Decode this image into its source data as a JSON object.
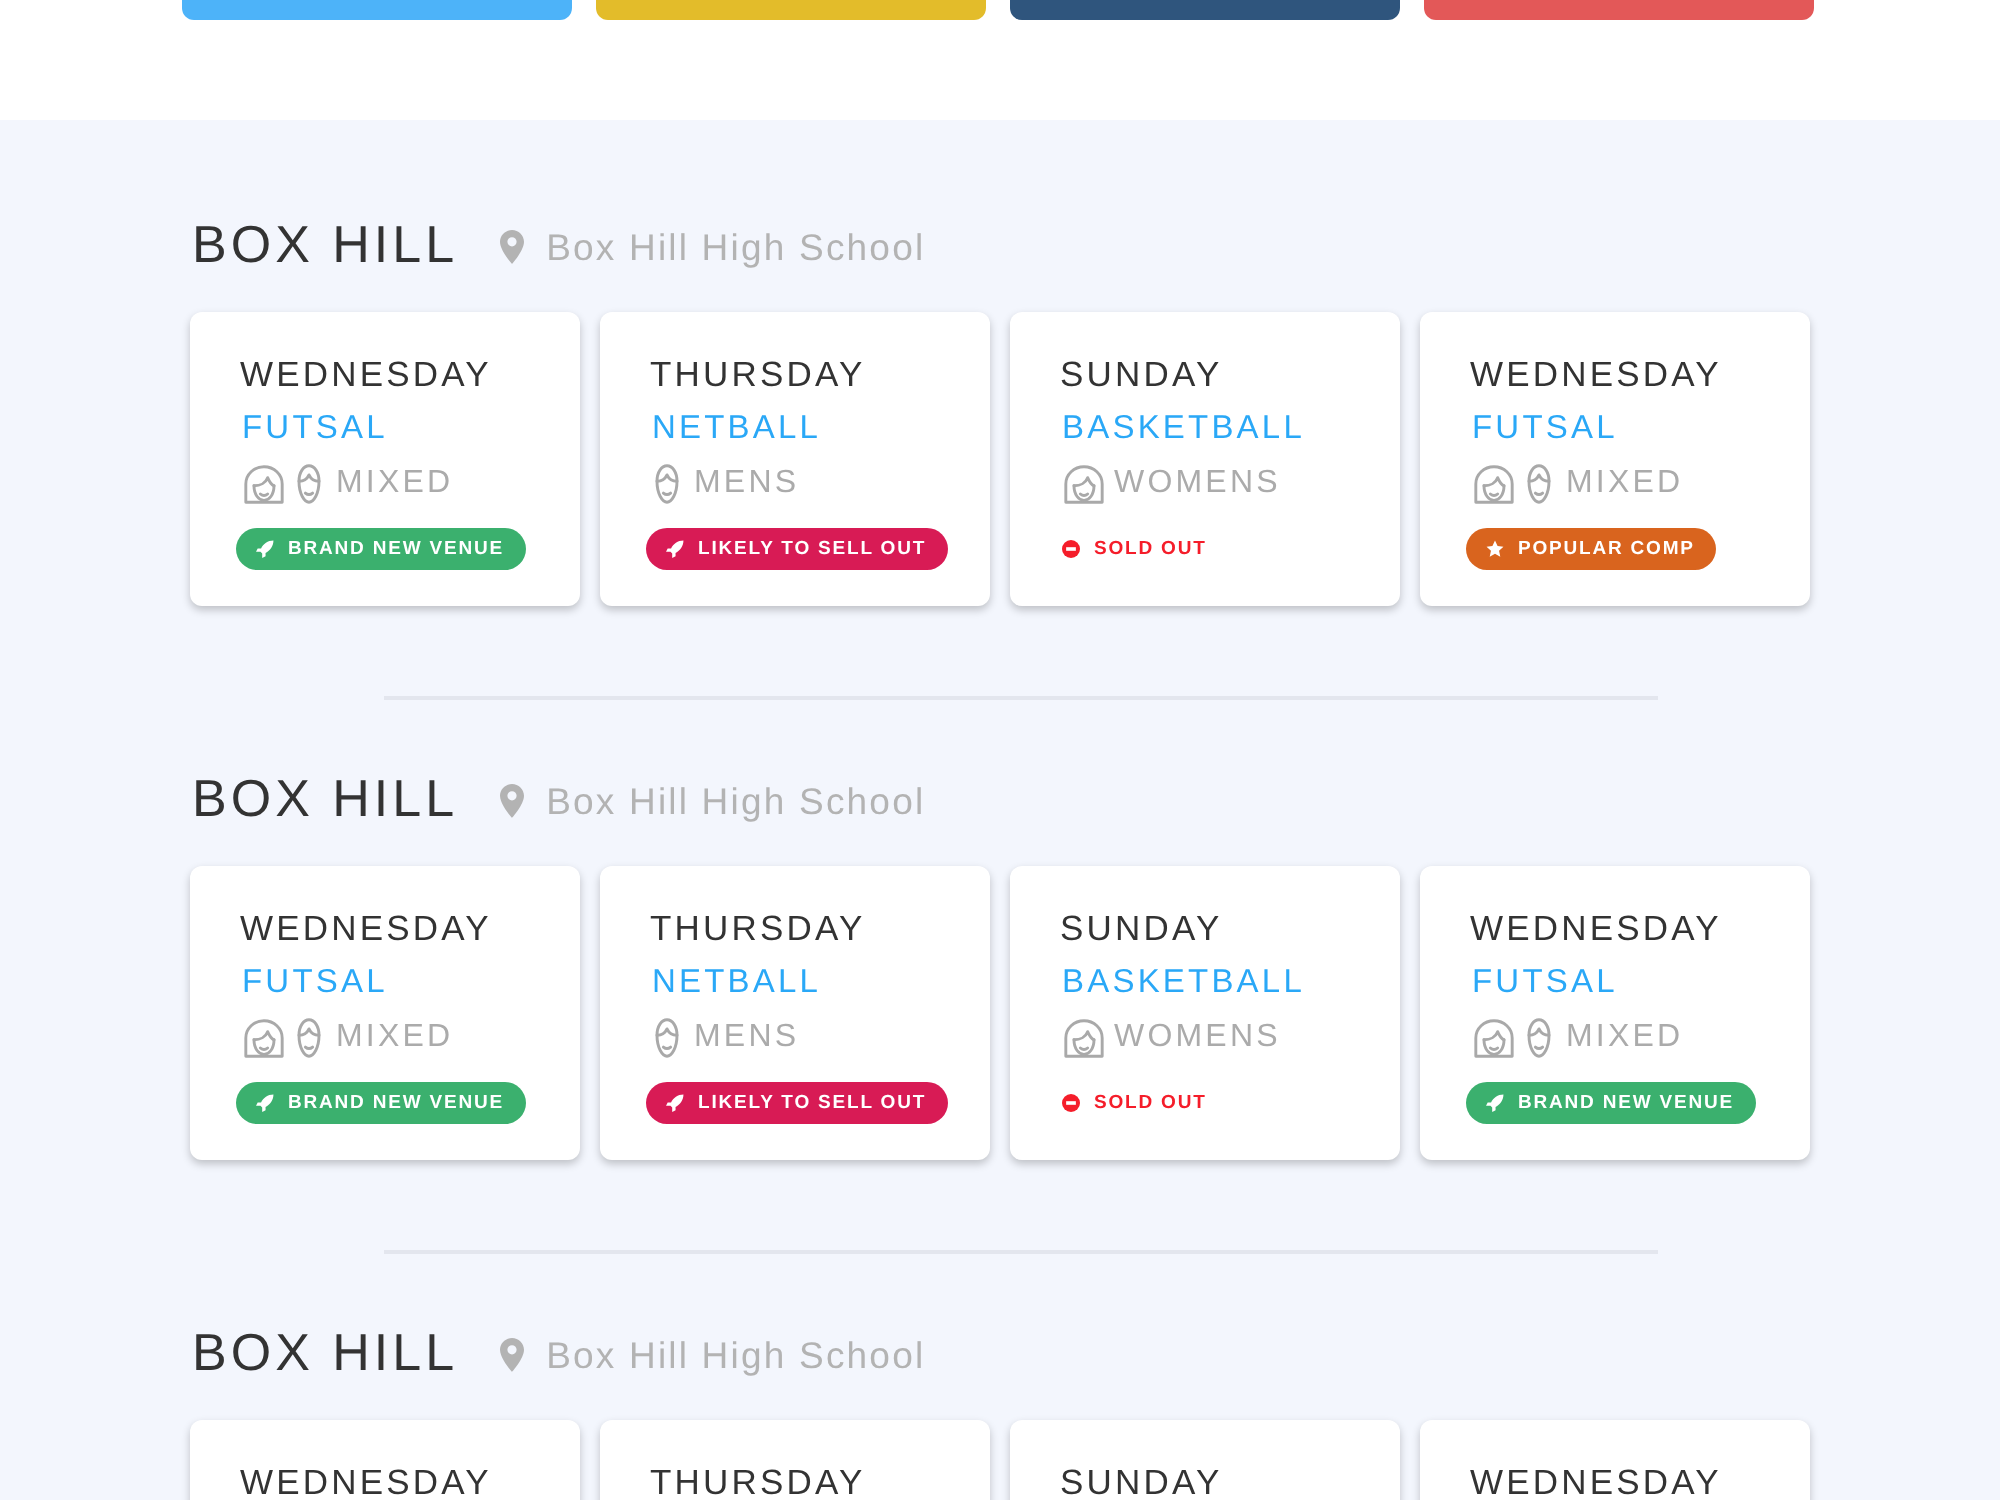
{
  "top_buttons": [
    {
      "color": "#4db3f9"
    },
    {
      "color": "#e3bc2a"
    },
    {
      "color": "#2f557d"
    },
    {
      "color": "#e35858"
    }
  ],
  "sections": [
    {
      "title": "BOX HILL",
      "venue": "Box Hill High School",
      "cards": [
        {
          "day": "WEDNESDAY",
          "sport": "FUTSAL",
          "audience": {
            "kind": "mixed",
            "label": "MIXED"
          },
          "badge": {
            "kind": "new",
            "label": "BRAND NEW VENUE"
          }
        },
        {
          "day": "THURSDAY",
          "sport": "NETBALL",
          "audience": {
            "kind": "mens",
            "label": "MENS"
          },
          "badge": {
            "kind": "hot",
            "label": "LIKELY TO SELL OUT"
          }
        },
        {
          "day": "SUNDAY",
          "sport": "BASKETBALL",
          "audience": {
            "kind": "womens",
            "label": "WOMENS"
          },
          "badge": {
            "kind": "sold_out",
            "label": "SOLD OUT"
          }
        },
        {
          "day": "WEDNESDAY",
          "sport": "FUTSAL",
          "audience": {
            "kind": "mixed",
            "label": "MIXED"
          },
          "badge": {
            "kind": "popular",
            "label": "POPULAR COMP"
          }
        }
      ]
    },
    {
      "title": "BOX HILL",
      "venue": "Box Hill High School",
      "cards": [
        {
          "day": "WEDNESDAY",
          "sport": "FUTSAL",
          "audience": {
            "kind": "mixed",
            "label": "MIXED"
          },
          "badge": {
            "kind": "new",
            "label": "BRAND NEW VENUE"
          }
        },
        {
          "day": "THURSDAY",
          "sport": "NETBALL",
          "audience": {
            "kind": "mens",
            "label": "MENS"
          },
          "badge": {
            "kind": "hot",
            "label": "LIKELY TO SELL OUT"
          }
        },
        {
          "day": "SUNDAY",
          "sport": "BASKETBALL",
          "audience": {
            "kind": "womens",
            "label": "WOMENS"
          },
          "badge": {
            "kind": "sold_out",
            "label": "SOLD OUT"
          }
        },
        {
          "day": "WEDNESDAY",
          "sport": "FUTSAL",
          "audience": {
            "kind": "mixed",
            "label": "MIXED"
          },
          "badge": {
            "kind": "new",
            "label": "BRAND NEW VENUE"
          }
        }
      ]
    },
    {
      "title": "BOX HILL",
      "venue": "Box Hill High School",
      "cards": [
        {
          "day": "WEDNESDAY"
        },
        {
          "day": "THURSDAY"
        },
        {
          "day": "SUNDAY"
        },
        {
          "day": "WEDNESDAY"
        }
      ]
    }
  ]
}
